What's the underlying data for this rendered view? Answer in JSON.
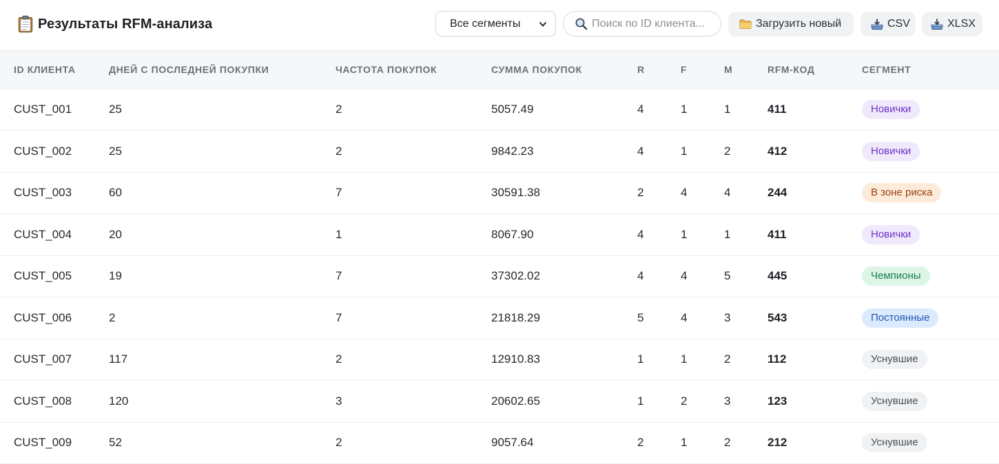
{
  "header": {
    "title": "Результаты RFM-анализа",
    "icon": "clipboard-icon"
  },
  "toolbar": {
    "segment_select": {
      "value": "Все сегменты",
      "icon": "chevron-down-icon"
    },
    "search": {
      "placeholder": "Поиск по ID клиента...",
      "value": "",
      "icon": "magnifier-icon"
    },
    "upload_button": {
      "label": "Загрузить новый",
      "icon": "folder-icon"
    },
    "csv_button": {
      "label": "CSV",
      "icon": "download-tray-icon"
    },
    "xlsx_button": {
      "label": "XLSX",
      "icon": "download-tray-icon"
    }
  },
  "table": {
    "columns": [
      "ID КЛИЕНТА",
      "ДНЕЙ С ПОСЛЕДНЕЙ ПОКУПКИ",
      "ЧАСТОТА ПОКУПОК",
      "СУММА ПОКУПОК",
      "R",
      "F",
      "M",
      "RFM-КОД",
      "СЕГМЕНТ"
    ],
    "rows": [
      {
        "id": "CUST_001",
        "days": "25",
        "freq": "2",
        "sum": "5057.49",
        "r": "4",
        "f": "1",
        "m": "1",
        "code": "411",
        "segment": "Новички",
        "seg_type": "new"
      },
      {
        "id": "CUST_002",
        "days": "25",
        "freq": "2",
        "sum": "9842.23",
        "r": "4",
        "f": "1",
        "m": "2",
        "code": "412",
        "segment": "Новички",
        "seg_type": "new"
      },
      {
        "id": "CUST_003",
        "days": "60",
        "freq": "7",
        "sum": "30591.38",
        "r": "2",
        "f": "4",
        "m": "4",
        "code": "244",
        "segment": "В зоне риска",
        "seg_type": "risk"
      },
      {
        "id": "CUST_004",
        "days": "20",
        "freq": "1",
        "sum": "8067.90",
        "r": "4",
        "f": "1",
        "m": "1",
        "code": "411",
        "segment": "Новички",
        "seg_type": "new"
      },
      {
        "id": "CUST_005",
        "days": "19",
        "freq": "7",
        "sum": "37302.02",
        "r": "4",
        "f": "4",
        "m": "5",
        "code": "445",
        "segment": "Чемпионы",
        "seg_type": "champ"
      },
      {
        "id": "CUST_006",
        "days": "2",
        "freq": "7",
        "sum": "21818.29",
        "r": "5",
        "f": "4",
        "m": "3",
        "code": "543",
        "segment": "Постоянные",
        "seg_type": "loyal"
      },
      {
        "id": "CUST_007",
        "days": "117",
        "freq": "2",
        "sum": "12910.83",
        "r": "1",
        "f": "1",
        "m": "2",
        "code": "112",
        "segment": "Уснувшие",
        "seg_type": "sleep"
      },
      {
        "id": "CUST_008",
        "days": "120",
        "freq": "3",
        "sum": "20602.65",
        "r": "1",
        "f": "2",
        "m": "3",
        "code": "123",
        "segment": "Уснувшие",
        "seg_type": "sleep"
      },
      {
        "id": "CUST_009",
        "days": "52",
        "freq": "2",
        "sum": "9057.64",
        "r": "2",
        "f": "1",
        "m": "2",
        "code": "212",
        "segment": "Уснувшие",
        "seg_type": "sleep"
      }
    ]
  },
  "segment_colors": {
    "new": {
      "bg": "#efe9fb",
      "fg": "#6b34c8"
    },
    "risk": {
      "bg": "#fdebd9",
      "fg": "#9a3f0d"
    },
    "champ": {
      "bg": "#dcf5e6",
      "fg": "#17804a"
    },
    "loyal": {
      "bg": "#dceafd",
      "fg": "#1f58b5"
    },
    "sleep": {
      "bg": "#f1f2f4",
      "fg": "#4a4f57"
    }
  }
}
